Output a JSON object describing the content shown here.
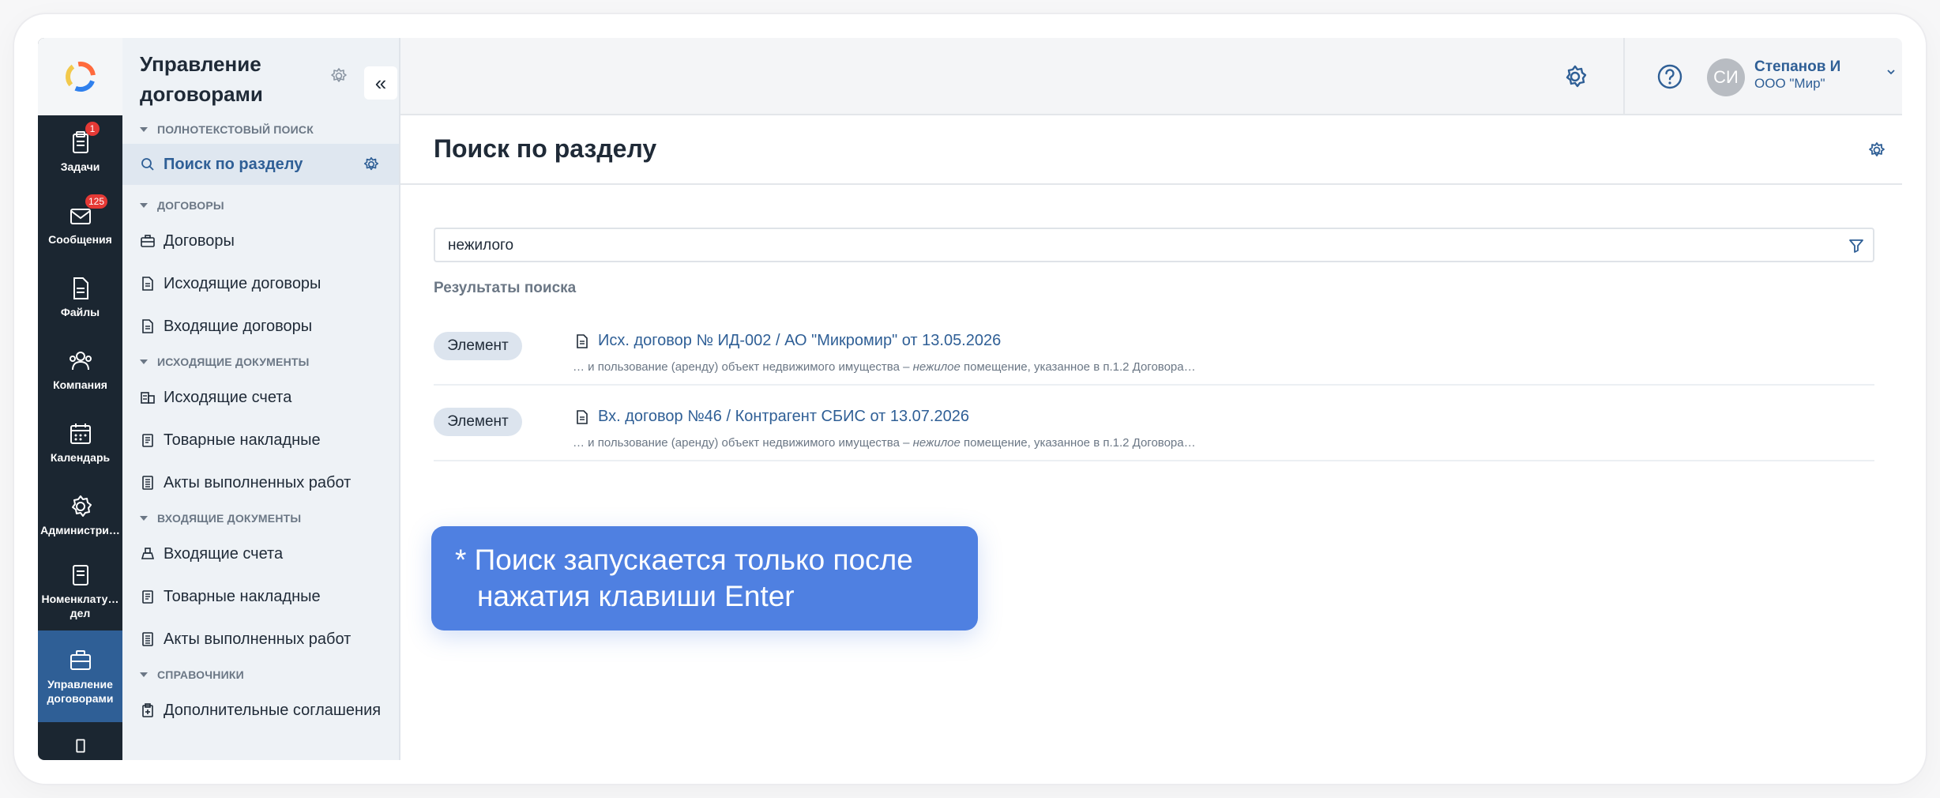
{
  "rail": {
    "items": [
      {
        "label": "Задачи",
        "icon": "clipboard-icon",
        "badge": "1"
      },
      {
        "label": "Сообщения",
        "icon": "mail-icon",
        "badge": "125"
      },
      {
        "label": "Файлы",
        "icon": "file-icon"
      },
      {
        "label": "Компания",
        "icon": "people-icon"
      },
      {
        "label": "Календарь",
        "icon": "calendar-icon"
      },
      {
        "label": "Администри…",
        "icon": "gear-icon"
      },
      {
        "label": "Номенклату… дел",
        "icon": "book-icon"
      },
      {
        "label": "Управление договорами",
        "icon": "briefcase-icon",
        "active": true
      }
    ]
  },
  "sidebar": {
    "title": "Управление договорами",
    "collapse_label": "«",
    "groups": {
      "fulltext": "ПОЛНОТЕКСТОВЫЙ ПОИСК",
      "contracts": "ДОГОВОРЫ",
      "outgoing_docs": "ИСХОДЯЩИЕ ДОКУМЕНТЫ",
      "incoming_docs": "ВХОДЯЩИЕ ДОКУМЕНТЫ",
      "references": "СПРАВОЧНИКИ"
    },
    "items": {
      "section_search": "Поиск по разделу",
      "contracts": "Договоры",
      "outgoing_contracts": "Исходящие договоры",
      "incoming_contracts": "Входящие договоры",
      "outgoing_invoices": "Исходящие счета",
      "outgoing_waybills": "Товарные накладные",
      "outgoing_acts": "Акты выполненных работ",
      "incoming_invoices": "Входящие счета",
      "incoming_waybills": "Товарные накладные",
      "incoming_acts": "Акты выполненных работ",
      "supplements": "Дополнительные соглашения"
    }
  },
  "header": {
    "user_initials": "СИ",
    "user_name": "Степанов И",
    "user_org": "ООО \"Мир\""
  },
  "page": {
    "title": "Поиск по разделу",
    "search_value": "нежилого",
    "results_title": "Результаты поиска",
    "results": [
      {
        "chip": "Элемент",
        "link": "Исх. договор № ИД-002 / АО \"Микромир\" от 13.05.2026",
        "snippet_before": "… и пользование (аренду) объект недвижимого имущества – ",
        "snippet_hit": "нежилое",
        "snippet_after": " помещение, указанное в п.1.2 Договора…"
      },
      {
        "chip": "Элемент",
        "link": "Вх. договор №46 / Контрагент СБИС от 13.07.2026",
        "snippet_before": "… и пользование (аренду) объект недвижимого имущества – ",
        "snippet_hit": "нежилое",
        "snippet_after": " помещение, указанное в п.1.2 Договора…"
      }
    ]
  },
  "tooltip": {
    "line1": "* Поиск запускается только после",
    "line2": "нажатия клавиши Enter"
  },
  "colors": {
    "rail_bg": "#1b2631",
    "rail_active": "#2f5f96",
    "accent": "#2f5f96",
    "tooltip_bg": "#4f80e1",
    "badge": "#e53935"
  }
}
